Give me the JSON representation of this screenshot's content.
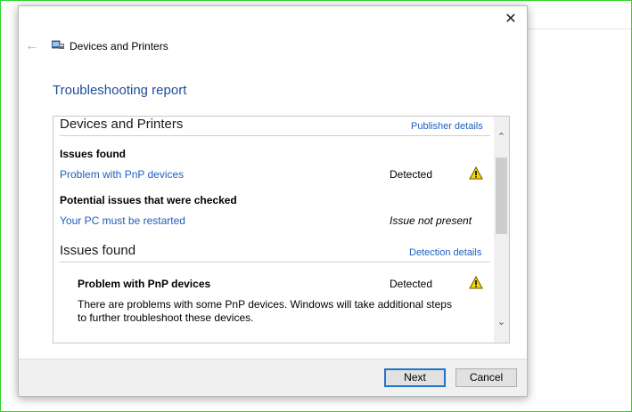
{
  "window": {
    "title": "Devices and Printers",
    "close_symbol": "✕",
    "back_symbol": "←"
  },
  "report": {
    "title": "Troubleshooting report",
    "summary_section": {
      "heading": "Devices and Printers",
      "link": "Publisher details",
      "issues_found_label": "Issues found",
      "issues": [
        {
          "name": "Problem with PnP devices",
          "status": "Detected"
        }
      ],
      "checked_label": "Potential issues that were checked",
      "checked": [
        {
          "name": "Your PC must be restarted",
          "status": "Issue not present"
        }
      ]
    },
    "detail_section": {
      "heading": "Issues found",
      "link": "Detection details",
      "issue_name": "Problem with PnP devices",
      "issue_status": "Detected",
      "description": "There are problems with some PnP devices. Windows will take additional steps to further troubleshoot these devices."
    }
  },
  "buttons": {
    "next": "Next",
    "cancel": "Cancel"
  },
  "colors": {
    "link": "#1e5fbe",
    "title": "#1e4c9a",
    "warning": "#f5d400",
    "frame": "#2fd32f"
  }
}
